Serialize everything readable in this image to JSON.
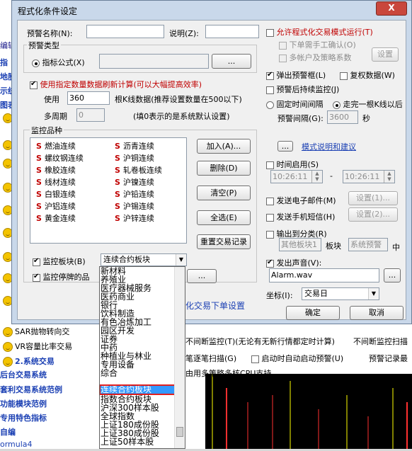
{
  "background": {
    "left_items": [
      "编辑",
      "指",
      "地股",
      "示统",
      "图表"
    ],
    "tree_items": [
      {
        "icon": "smiley-icon",
        "label": "SAR抛物转向交"
      },
      {
        "icon": "smiley-icon",
        "label": "VR容量比率交易"
      },
      {
        "icon": "smiley-icon",
        "label": "2.系统交易"
      },
      {
        "icon": "none",
        "label": "后台交易系统"
      },
      {
        "icon": "none",
        "label": "套利交易系统范例"
      },
      {
        "icon": "none",
        "label": "功能模块范例"
      },
      {
        "icon": "none",
        "label": "专用特色指标"
      },
      {
        "icon": "none",
        "label": "自编"
      },
      {
        "icon": "none",
        "label": "ormula4"
      }
    ],
    "bottom_texts": {
      "nonstop_monitor": "不间断监控(T)(无论有无新行情都定时计算)",
      "nonstop_monitor_right": "不间断监控扫描",
      "tick_scan": "笔逐笔扫描(G)",
      "auto_start": "启动时自动启动预警(U)",
      "warning_record": "预警记录最",
      "multi_cpu": "由用多策略多核CPU支持",
      "trade_settings": "化交易下单设置"
    }
  },
  "dialog": {
    "title": "程式化条件设定",
    "close_label": "X",
    "warning_name_label": "预警名称(N):",
    "warning_name_value": "",
    "description_label": "说明(Z):",
    "description_value": "",
    "warning_type_label": "预警类型",
    "indicator_formula_label": "指标公式(X)",
    "indicator_formula_value": "",
    "browse_label": "...",
    "use_data_label": "使用指定数量数据刷新计算(可以大幅提高效率)",
    "use_label": "使用",
    "use_value": "360",
    "kline_label": "根K线数据(推荐设置数量在500以下)",
    "multi_period_label": "多周期",
    "multi_period_value": "0",
    "multi_period_hint": "(填0表示的是系统默认设置)",
    "monitor_stocks_label": "监控品种",
    "stocks": [
      {
        "s": "S",
        "name": "燃油连续"
      },
      {
        "s": "S",
        "name": "沥青连续"
      },
      {
        "s": "S",
        "name": "螺纹钢连续"
      },
      {
        "s": "S",
        "name": "沪铜连续"
      },
      {
        "s": "S",
        "name": "橡胶连续"
      },
      {
        "s": "S",
        "name": "轧卷板连续"
      },
      {
        "s": "S",
        "name": "线材连续"
      },
      {
        "s": "S",
        "name": "沪镍连续"
      },
      {
        "s": "S",
        "name": "白银连续"
      },
      {
        "s": "S",
        "name": "沪铅连续"
      },
      {
        "s": "S",
        "name": "沪铝连续"
      },
      {
        "s": "S",
        "name": "沪锡连续"
      },
      {
        "s": "S",
        "name": "黄金连续"
      },
      {
        "s": "S",
        "name": "沪锌连续"
      }
    ],
    "add_label": "加入(A)...",
    "delete_label": "删除(D)",
    "clear_label": "清空(P)",
    "select_all_label": "全选(E)",
    "reset_record_label": "重置交易记录",
    "monitor_board_label": "监控板块(B)",
    "monitor_board_value": "连续合约板块",
    "monitor_suspended_label": "监控停牌的品",
    "allow_program_trade_label": "允许程式化交易模式运行(T)",
    "manual_confirm_label": "下单需手工确认(O)",
    "multi_account_label": "多帐户及策略系数",
    "settings_label": "设置",
    "popup_warning_label": "弹出预警框(L)",
    "rewarning_label": "复权数据(W)",
    "continue_monitor_label": "预警后持续监控(J)",
    "fixed_interval_label": "固定时间间隔",
    "one_kline_label": "走完一根K线以后",
    "warning_interval_label": "预警间隔(G):",
    "warning_interval_value": "3600",
    "seconds_label": "秒",
    "more_label": "...",
    "mode_desc_label": "模式说明和建议",
    "time_enable_label": "时间启用(S)",
    "time_start": "10:26:11",
    "time_end": "10:26:11",
    "time_sep": "-",
    "send_email_label": "发送电子邮件(M)",
    "settings1_label": "设置(1)...",
    "send_sms_label": "发送手机短信(H)",
    "settings2_label": "设置(2)...",
    "output_category_label": "输出到分类(R)",
    "other_board_label": "其他板块1",
    "board_label": "板块",
    "system_warning_label": "系统预警",
    "zhong_label": "中",
    "sound_label": "发出声音(V):",
    "sound_file": "Alarm.wav",
    "sound_browse": "...",
    "coord_label": "坐标(I):",
    "coord_value": "交易日",
    "ok_label": "确定",
    "cancel_label": "取消",
    "suspend_browse": "..."
  },
  "dropdown": {
    "items": [
      "新材料",
      "养殖业",
      "医疗器械服务",
      "医药商业",
      "银行",
      "饮料制造",
      "有色冶炼加工",
      "园区开发",
      "证券",
      "中药",
      "种植业与林业",
      "专用设备",
      "综合",
      "连续合约板块",
      "指数合约板块",
      "沪深300样本股",
      "全球指数",
      "上证180成份股",
      "上证380成份股",
      "上证50样本股"
    ],
    "selected": "连续合约板块"
  }
}
